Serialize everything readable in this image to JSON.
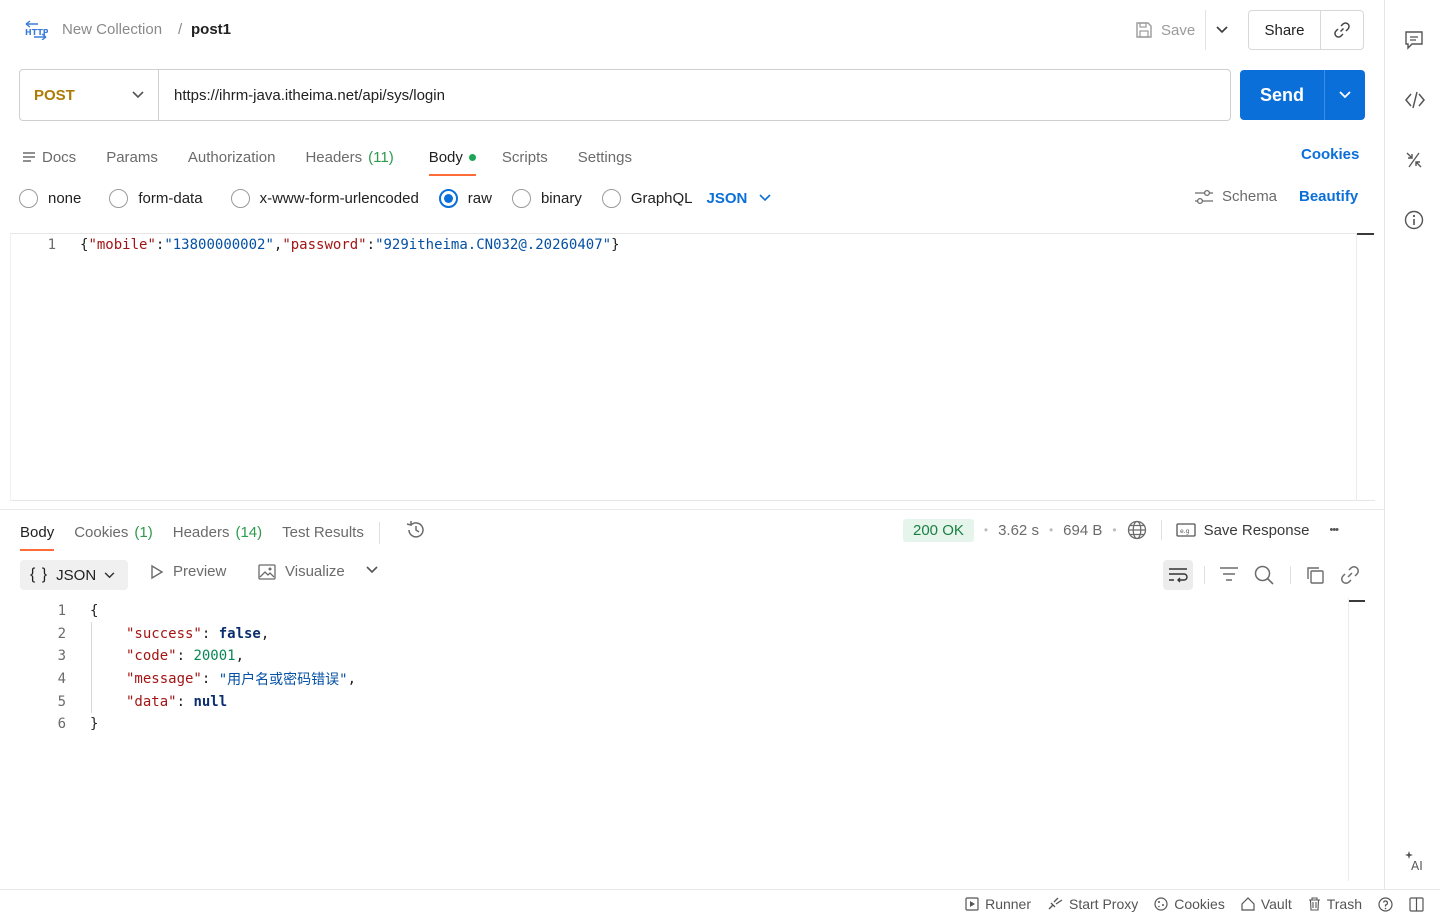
{
  "header": {
    "app_icon": "http-icon",
    "collection": "New Collection",
    "separator": "/",
    "request_name": "post1",
    "save_label": "Save",
    "share_label": "Share"
  },
  "request": {
    "method": "POST",
    "url": "https://ihrm-java.itheima.net/api/sys/login",
    "send_label": "Send"
  },
  "req_tabs": [
    {
      "label": "Docs"
    },
    {
      "label": "Params"
    },
    {
      "label": "Authorization"
    },
    {
      "label": "Headers",
      "count": "(11)"
    },
    {
      "label": "Body",
      "active": true
    },
    {
      "label": "Scripts"
    },
    {
      "label": "Settings"
    }
  ],
  "cookies_label": "Cookies",
  "body_types": [
    {
      "label": "none",
      "checked": false
    },
    {
      "label": "form-data",
      "checked": false
    },
    {
      "label": "x-www-form-urlencoded",
      "checked": false
    },
    {
      "label": "raw",
      "checked": true
    },
    {
      "label": "binary",
      "checked": false
    },
    {
      "label": "GraphQL",
      "checked": false
    }
  ],
  "body_format": "JSON",
  "schema_label": "Schema",
  "beautify_label": "Beautify",
  "request_body": {
    "line_number": "1",
    "open": "{",
    "key1": "\"mobile\"",
    "colon": ":",
    "val1": "\"13800000002\"",
    "comma": ",",
    "key2": "\"password\"",
    "val2": "\"929itheima.CN032@.20260407\"",
    "close": "}"
  },
  "resp_tabs": [
    {
      "label": "Body",
      "active": true
    },
    {
      "label": "Cookies",
      "count": "(1)"
    },
    {
      "label": "Headers",
      "count": "(14)"
    },
    {
      "label": "Test Results"
    }
  ],
  "status": {
    "code": "200 OK",
    "time": "3.62 s",
    "size": "694 B",
    "save_response": "Save Response",
    "more": "•••"
  },
  "resp_toolbar": {
    "format": "JSON",
    "format_braces": "{ }",
    "preview": "Preview",
    "visualize": "Visualize"
  },
  "response_body": {
    "ln": [
      "1",
      "2",
      "3",
      "4",
      "5",
      "6"
    ],
    "open": "{",
    "k_success": "\"success\"",
    "v_success": "false",
    "k_code": "\"code\"",
    "v_code": "20001",
    "k_message": "\"message\"",
    "v_message": "\"用户名或密码错误\"",
    "k_data": "\"data\"",
    "v_data": "null",
    "close": "}",
    "colon": ": ",
    "comma": ","
  },
  "footer": {
    "runner": "Runner",
    "start_proxy": "Start Proxy",
    "cookies": "Cookies",
    "vault": "Vault",
    "trash": "Trash"
  },
  "colors": {
    "accent": "#0b6fda",
    "method": "#ad7a03",
    "tab_underline": "#ff6c37",
    "status_ok": "#1a7f42"
  }
}
